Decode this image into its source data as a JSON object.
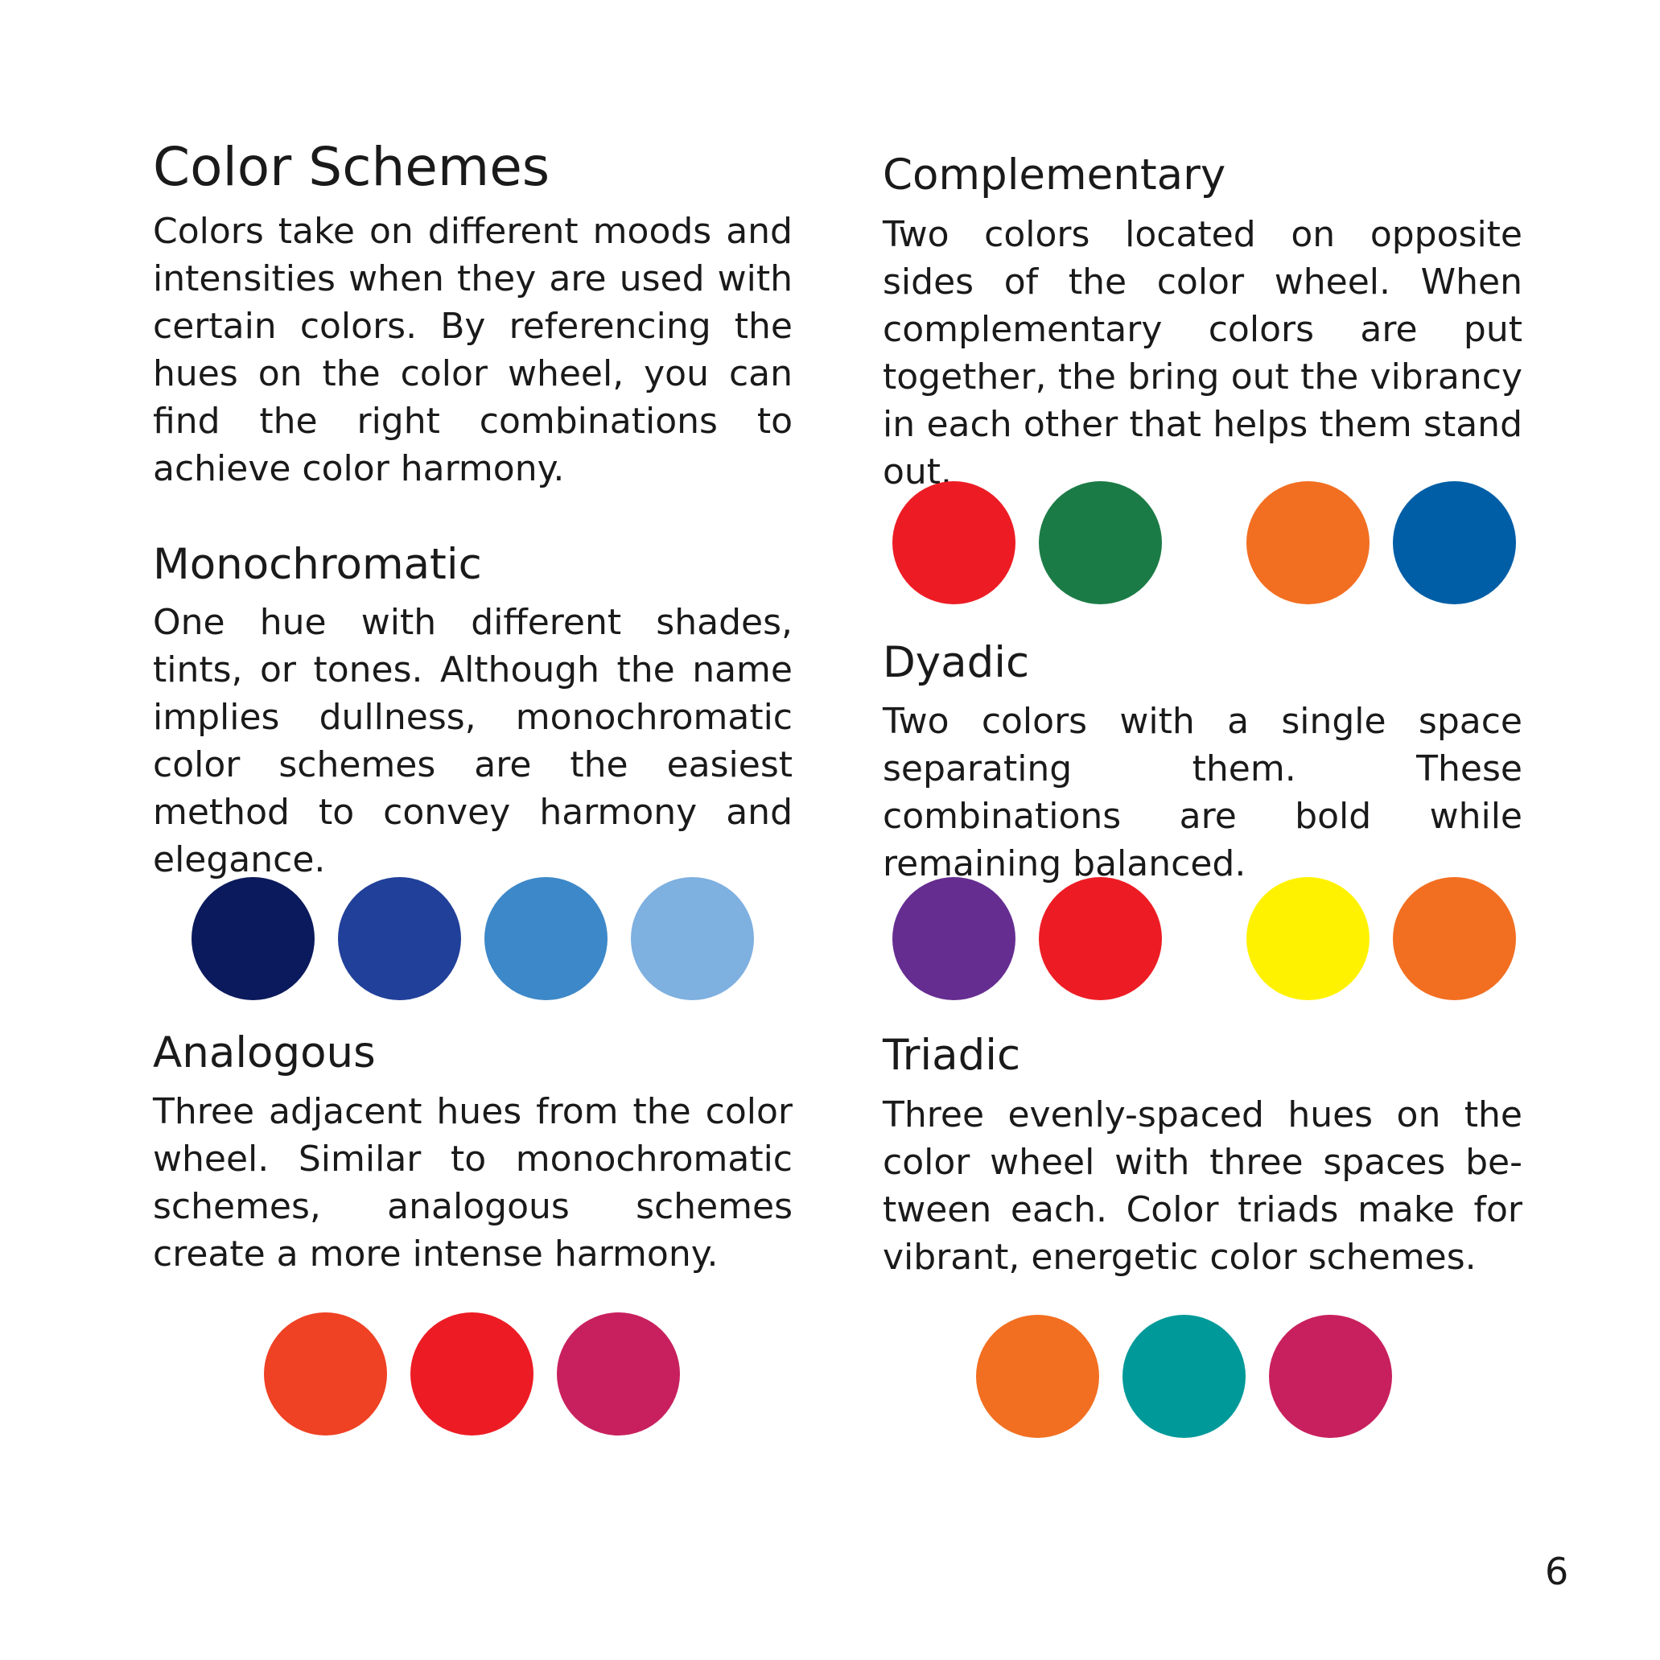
{
  "title": "Color Schemes",
  "intro": "Colors take on different moods and intensities when they are used with certain colors. By referencing the hues on the color wheel, you can find the right combinations to achieve color harmony.",
  "monochromatic": {
    "heading": "Monochromatic",
    "text": "One hue with different shades, tints, or tones. Although the name im­plies dullness, monochromatic color schemes are the easiest method to convey harmony and elegance.",
    "colors": [
      "#0b1a5c",
      "#21409a",
      "#3d88c8",
      "#7eb0e0"
    ]
  },
  "analogous": {
    "heading": "Analogous",
    "text": "Three adjacent hues from the color wheel. Similar to monochromatic schemes, analogous schemes create a more intense harmony.",
    "colors": [
      "#ef4123",
      "#ed1c24",
      "#c8205e"
    ]
  },
  "complementary": {
    "heading": "Complementary",
    "text": "Two colors located on opposite sides of the color wheel. When com­plementary colors are put together, the bring out the vibrancy in each other that helps them stand out.",
    "colors": [
      "#ed1c24",
      "#1b7b46",
      "#f26f21",
      "#005ea6"
    ]
  },
  "dyadic": {
    "heading": "Dyadic",
    "text": "Two colors with a single space sepa­rating them. These combinations are bold while remaining balanced.",
    "colors": [
      "#662d91",
      "#ed1c24",
      "#fff200",
      "#f26f21"
    ]
  },
  "triadic": {
    "heading": "Triadic",
    "text": "Three evenly-spaced hues on the color wheel with three spaces be­tween each. Color triads make for vibrant, energetic color schemes.",
    "colors": [
      "#f26f21",
      "#009999",
      "#c8205e"
    ]
  },
  "page_number": "6"
}
